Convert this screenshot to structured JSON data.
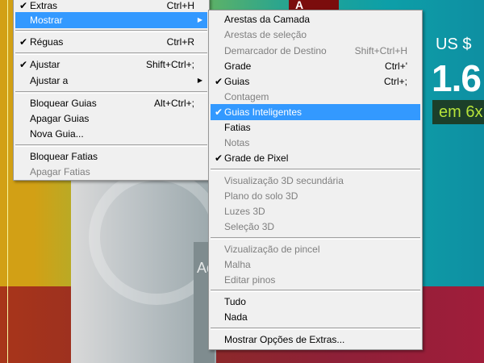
{
  "background": {
    "box_text": "Ad",
    "logo_text": "A",
    "price_currency": "US $",
    "price_value": "1.6",
    "price_installments": "em 6x"
  },
  "main_menu": {
    "items": [
      {
        "label": "Extras",
        "shortcut": "Ctrl+H",
        "checked": true,
        "disabled": false
      },
      {
        "label": "Mostrar",
        "submenu": true,
        "highlighted": true
      },
      {
        "label": "Réguas",
        "shortcut": "Ctrl+R",
        "checked": true
      },
      {
        "label": "Ajustar",
        "shortcut": "Shift+Ctrl+;",
        "checked": true
      },
      {
        "label": "Ajustar a",
        "submenu": true
      },
      {
        "label": "Bloquear Guias",
        "shortcut": "Alt+Ctrl+;"
      },
      {
        "label": "Apagar Guias"
      },
      {
        "label": "Nova Guia..."
      },
      {
        "label": "Bloquear Fatias"
      },
      {
        "label": "Apagar Fatias",
        "disabled": true
      }
    ]
  },
  "sub_menu": {
    "items": [
      {
        "label": "Arestas da Camada"
      },
      {
        "label": "Arestas de seleção",
        "disabled": true
      },
      {
        "label": "Demarcador de Destino",
        "shortcut": "Shift+Ctrl+H",
        "disabled": true
      },
      {
        "label": "Grade",
        "shortcut": "Ctrl+'"
      },
      {
        "label": "Guias",
        "shortcut": "Ctrl+;",
        "checked": true
      },
      {
        "label": "Contagem",
        "disabled": true
      },
      {
        "label": "Guias Inteligentes",
        "checked": true,
        "highlighted": true
      },
      {
        "label": "Fatias"
      },
      {
        "label": "Notas",
        "disabled": true
      },
      {
        "label": "Grade de Pixel",
        "checked": true
      },
      {
        "label": "Visualização 3D secundária",
        "disabled": true
      },
      {
        "label": "Plano do solo 3D",
        "disabled": true
      },
      {
        "label": "Luzes 3D",
        "disabled": true
      },
      {
        "label": "Seleção 3D",
        "disabled": true
      },
      {
        "label": "Vizualização de pincel",
        "disabled": true
      },
      {
        "label": "Malha",
        "disabled": true
      },
      {
        "label": "Editar pinos",
        "disabled": true
      },
      {
        "label": "Tudo"
      },
      {
        "label": "Nada"
      },
      {
        "label": "Mostrar Opções de Extras..."
      }
    ]
  },
  "icons": {
    "check": "checkmark-icon",
    "submenu_arrow": "triangle-right-icon"
  }
}
